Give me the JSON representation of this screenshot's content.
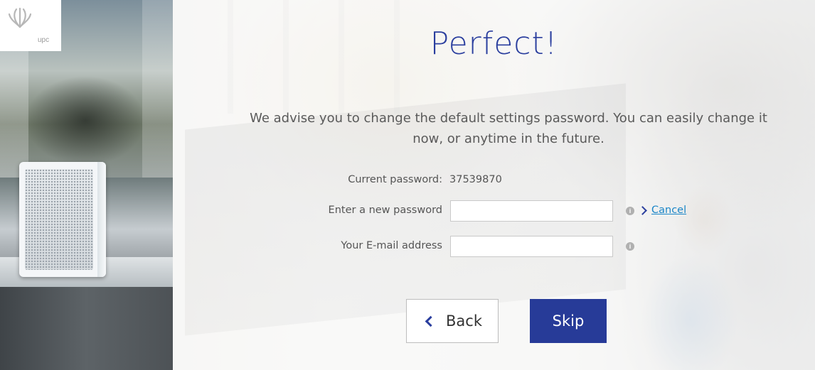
{
  "brand": {
    "logo_text": "upc"
  },
  "main": {
    "title": "Perfect!",
    "description_line1": "We advise you to change the default settings password. You can easily change it",
    "description_line2": "now, or anytime in the future."
  },
  "form": {
    "current_password_label": "Current password:",
    "current_password_value": "37539870",
    "new_password_label": "Enter a new password",
    "new_password_value": "",
    "email_label": "Your E-mail address",
    "email_value": "",
    "cancel_link": "Cancel"
  },
  "buttons": {
    "back_label": "Back",
    "skip_label": "Skip"
  },
  "colors": {
    "accent": "#273b98",
    "link": "#1b86c8"
  },
  "icons": [
    "upc-logo-icon",
    "info-icon",
    "chevron-right-icon",
    "chevron-left-icon"
  ]
}
